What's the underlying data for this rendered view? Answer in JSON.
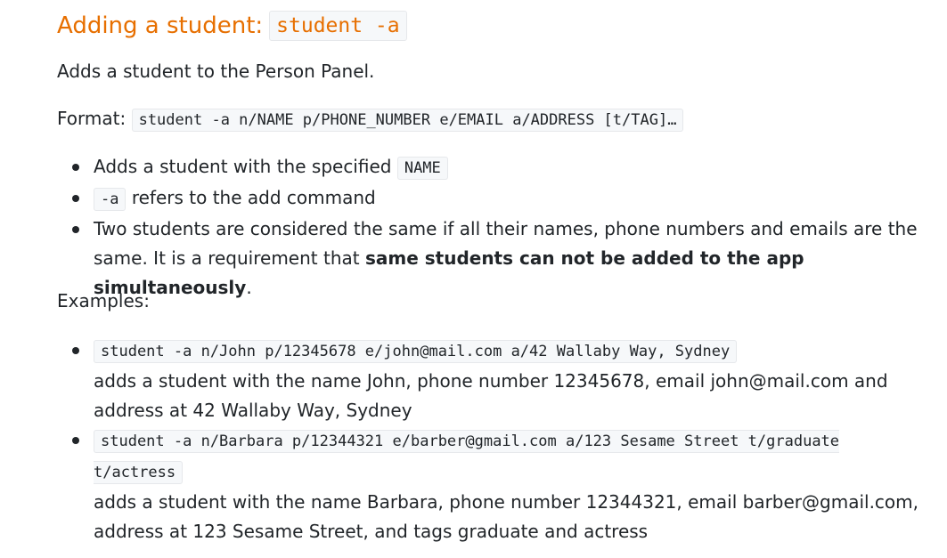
{
  "heading": {
    "text": "Adding a student:",
    "command": "student -a"
  },
  "description": "Adds a student to the Person Panel.",
  "format": {
    "label": "Format:",
    "code": "student -a n/NAME p/PHONE_NUMBER e/EMAIL a/ADDRESS [t/TAG]…"
  },
  "notes": [
    {
      "before": "Adds a student with the specified",
      "code": "NAME"
    },
    {
      "code": "-a",
      "after": "refers to the add command"
    },
    {
      "text": "Two students are considered the same if all their names, phone numbers and emails are the same. It is a requirement that",
      "bold": "same students can not be added to the app simultaneously",
      "end": "."
    }
  ],
  "examples_label": "Examples:",
  "examples": [
    {
      "code": "student -a n/John p/12345678 e/john@mail.com a/42 Wallaby Way, Sydney",
      "description": "adds a student with the name John, phone number 12345678, email john@mail.com and address at 42 Wallaby Way, Sydney"
    },
    {
      "code": "student -a n/Barbara p/12344321 e/barber@gmail.com a/123 Sesame Street t/graduate t/actress",
      "description": "adds a student with the name Barbara, phone number 12344321, email barber@gmail.com, address at 123 Sesame Street, and tags graduate and actress"
    }
  ]
}
